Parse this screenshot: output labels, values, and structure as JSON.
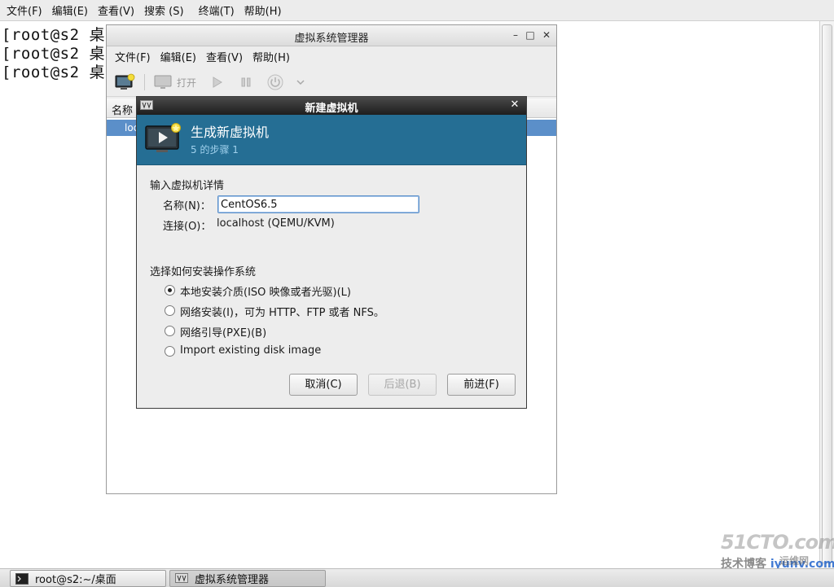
{
  "terminal": {
    "menu": [
      "文件(F)",
      "编辑(E)",
      "查看(V)",
      "搜索 (S)",
      "终端(T)",
      "帮助(H)"
    ],
    "lines": [
      "[root@s2 桌",
      "[root@s2 桌",
      "[root@s2 桌"
    ]
  },
  "vmm": {
    "title": "虚拟系统管理器",
    "menu": [
      "文件(F)",
      "编辑(E)",
      "查看(V)",
      "帮助(H)"
    ],
    "toolbar": {
      "open_label": "打开"
    },
    "list": {
      "column_name": "名称",
      "row_text": "loc"
    }
  },
  "dialog": {
    "title": "新建虚拟机",
    "banner_title": "生成新虚拟机",
    "banner_step": "5 的步骤 1",
    "section_details": "输入虚拟机详情",
    "name_label": "名称(N)：",
    "name_value": "CentOS6.5",
    "connection_label": "连接(O)：",
    "connection_value": "localhost (QEMU/KVM)",
    "section_install": "选择如何安装操作系统",
    "install_options": [
      {
        "label": "本地安装介质(ISO 映像或者光驱)(L)",
        "selected": true
      },
      {
        "label": "网络安装(I)，可为 HTTP、FTP 或者 NFS。",
        "selected": false
      },
      {
        "label": "网络引导(PXE)(B)",
        "selected": false
      },
      {
        "label": "Import existing disk image",
        "selected": false
      }
    ],
    "buttons": {
      "cancel": "取消(C)",
      "back": "后退(B)",
      "forward": "前进(F)"
    }
  },
  "taskbar": {
    "items": [
      "root@s2:~/桌面",
      "虚拟系统管理器"
    ]
  },
  "watermark": {
    "big": "51CTO.com",
    "small": "技术博客",
    "url": "iyunv.com",
    "extra": "运维网"
  },
  "colors": {
    "banner": "#256e94",
    "selection": "#5b8fc9",
    "dialog_title": "#1e1e1e"
  }
}
